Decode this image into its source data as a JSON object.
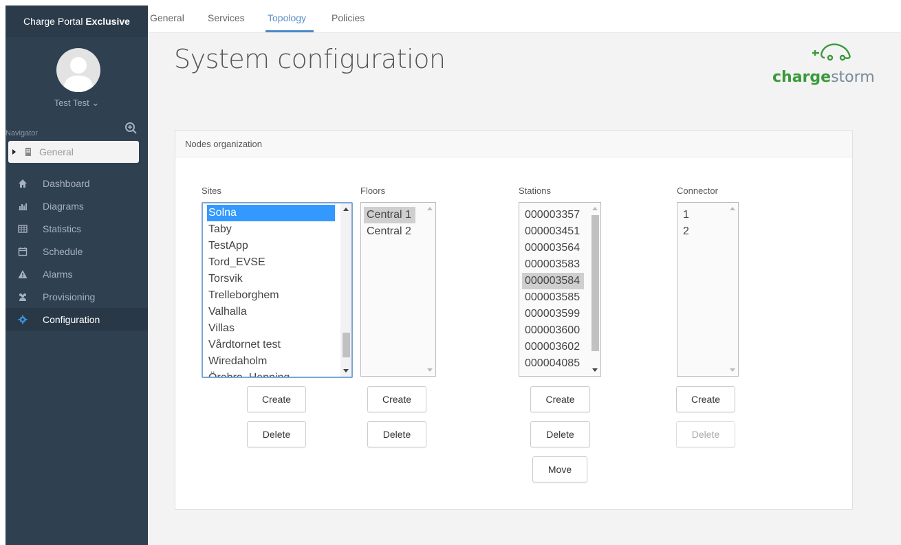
{
  "app": {
    "brand_prefix": "Charge Portal",
    "brand_bold": "Exclusive"
  },
  "user": {
    "name": "Test Test ⌄"
  },
  "navigator": {
    "label": "Navigator",
    "general": "General",
    "items": [
      {
        "label": "Dashboard",
        "icon": "home-icon"
      },
      {
        "label": "Diagrams",
        "icon": "bar-chart-icon"
      },
      {
        "label": "Statistics",
        "icon": "table-icon"
      },
      {
        "label": "Schedule",
        "icon": "calendar-icon"
      },
      {
        "label": "Alarms",
        "icon": "warning-icon"
      },
      {
        "label": "Provisioning",
        "icon": "users-icon"
      },
      {
        "label": "Configuration",
        "icon": "gear-icon",
        "active": true
      }
    ]
  },
  "tabs": [
    {
      "label": "General"
    },
    {
      "label": "Services"
    },
    {
      "label": "Topology",
      "active": true
    },
    {
      "label": "Policies"
    }
  ],
  "page": {
    "title": "System configuration"
  },
  "logo": {
    "part1": "charge",
    "part2": "storm"
  },
  "panel": {
    "title": "Nodes organization"
  },
  "columns": {
    "sites": {
      "label": "Sites",
      "options": [
        "Solna",
        "Taby",
        "TestApp",
        "Tord_EVSE",
        "Torsvik",
        "Trelleborghem",
        "Valhalla",
        "Villas",
        "Vårdtornet test",
        "Wiredaholm",
        "Örebro_Hepping"
      ],
      "selected": "Solna"
    },
    "floors": {
      "label": "Floors",
      "options": [
        "Central 1",
        "Central 2"
      ],
      "selected": "Central 1"
    },
    "stations": {
      "label": "Stations",
      "options": [
        "000003357",
        "000003451",
        "000003564",
        "000003583",
        "000003584",
        "000003585",
        "000003599",
        "000003600",
        "000003602",
        "000004085"
      ],
      "selected": "000003584"
    },
    "connector": {
      "label": "Connector",
      "options": [
        "1",
        "2"
      ]
    }
  },
  "buttons": {
    "create": "Create",
    "delete": "Delete",
    "move": "Move"
  },
  "colors": {
    "sidebar": "#2f4050",
    "accent": "#4a89c8",
    "logo_green": "#3a9a3a",
    "selection": "#3399ff"
  }
}
